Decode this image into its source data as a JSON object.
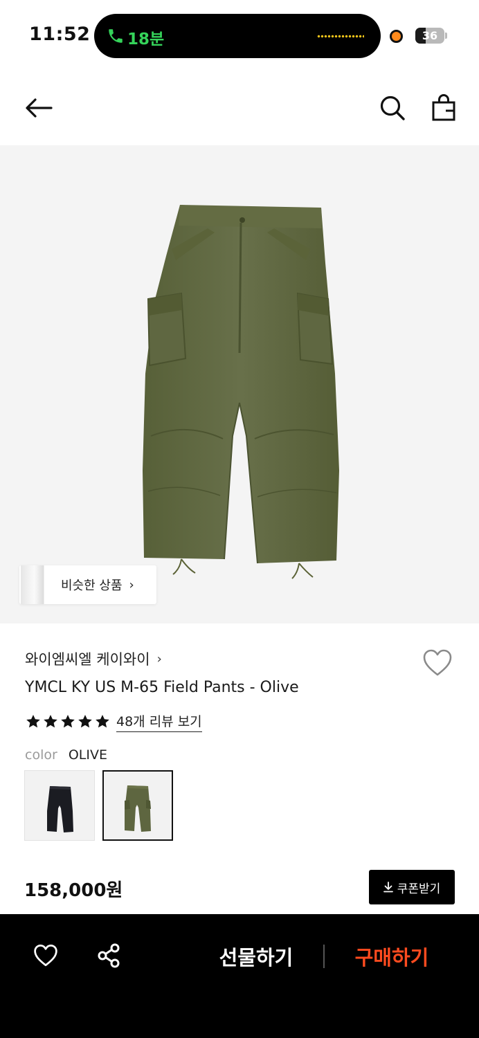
{
  "status_bar": {
    "time": "11:52",
    "call_duration": "18분",
    "battery_level": "36",
    "battery_fraction": 0.36
  },
  "header": {
    "back_icon": "arrow-left-icon",
    "search_icon": "search-icon",
    "cart_icon": "shopping-bag-icon"
  },
  "hero": {
    "similar_label": "비슷한 상품",
    "similar_chevron": "›"
  },
  "product": {
    "brand": "와이엠씨엘 케이와이",
    "brand_chevron": "›",
    "name": "YMCL KY US M-65 Field Pants - Olive",
    "rating": 5,
    "reviews_label": "48개 리뷰 보기",
    "color_label": "color",
    "color_value": "OLIVE",
    "swatches": [
      {
        "name": "black",
        "selected": false
      },
      {
        "name": "olive",
        "selected": true
      }
    ],
    "price": "158,000원",
    "coupon_label": "쿠폰받기"
  },
  "bottom_bar": {
    "gift_label": "선물하기",
    "buy_label": "구매하기"
  },
  "colors": {
    "accent": "#ff4b1f",
    "call_green": "#35d35a",
    "olive": "#5e6640",
    "black_pants": "#1b1c22"
  }
}
